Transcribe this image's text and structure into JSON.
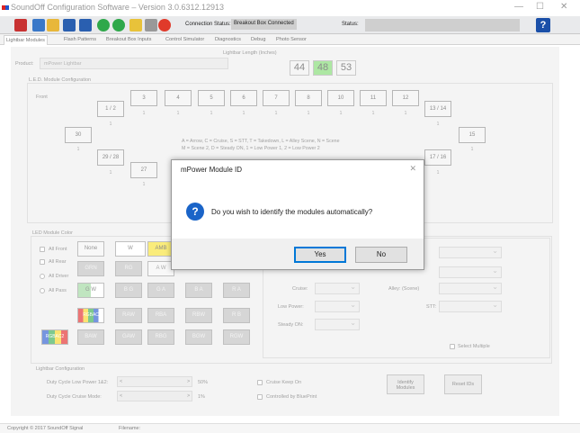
{
  "window": {
    "title": "SoundOff Configuration Software – Version 3.0.6312.12913",
    "minimize": "—",
    "maximize": "☐",
    "close": "✕"
  },
  "toolbar": {
    "connection_status_label": "Connection Status:",
    "connection_status_value": "Breakout Box Connected",
    "status_label": "Status:",
    "status_value": ""
  },
  "tabs": [
    "Lightbar Modules",
    "Flash Patterns",
    "Breakout Box Inputs",
    "Control Simulator",
    "Diagnostics",
    "Debug",
    "Photo Sensor"
  ],
  "product": {
    "label": "Product:",
    "value": "mPower Lightbar"
  },
  "lightbar_length": {
    "label": "Lightbar Length (Inches)",
    "options": [
      "44",
      "48",
      "53"
    ],
    "selected": "48",
    "selected_color": "#7bd96b"
  },
  "led_config": {
    "title": "L.E.D. Module Configuration",
    "front_label": "Front",
    "top_row": [
      "3",
      "4",
      "5",
      "6",
      "7",
      "8",
      "10",
      "11",
      "12"
    ],
    "left_box": "1 / 2",
    "right_box": "13 / 14",
    "side_left": "30",
    "side_right": "15",
    "lower_left": "29 / 28",
    "lower_right": "17 / 16",
    "mid_left": "27",
    "one_label": "1",
    "legend_line1": "A = Arrow, C = Cruise, S = STT, T = Takedown, L = Alley Scene, N = Scene",
    "legend_line2": "M = Scene 2, D = Steady ON, 1 = Low Power 1, 2 = Low Power 2"
  },
  "module_color": {
    "title": "LED Module Color",
    "options": [
      "All Front",
      "All Rear",
      "All Driver",
      "All Pass"
    ],
    "top_buttons": [
      "None",
      "W",
      "AMB"
    ],
    "row1": [
      "GRN",
      "RG"
    ],
    "row1_aw": "A W",
    "row2": [
      "G W",
      "B G",
      "G A",
      "B A",
      "R A"
    ],
    "row3": [
      "RGBAC",
      "RAW",
      "RBA",
      "RBW",
      "R B"
    ],
    "row4": [
      "RGBAC2",
      "BAW",
      "GAW",
      "RBG",
      "BGW",
      "RGW"
    ]
  },
  "functions": {
    "cruise_label": "Cruise:",
    "low_power_label": "Low Power:",
    "steady_on_label": "Steady ON:",
    "alley_label": "Alley: (Scene)",
    "stt_label": "STT:",
    "select_multiple": "Select Multiple"
  },
  "lightbar_config": {
    "title": "Lightbar Configuration",
    "duty_low_label": "Duty Cycle Low Power 1&2:",
    "duty_low_value": "50%",
    "duty_cruise_label": "Duty Cycle Cruise Mode:",
    "duty_cruise_value": "1%",
    "cruise_keep_on": "Cruise Keep On",
    "controlled_by": "Controlled by BluePrint",
    "identify_modules": "Identify Modules",
    "reset_ids": "Reset IDs"
  },
  "statusbar": {
    "copyright": "Copyright © 2017 SoundOff Signal",
    "filename_label": "Filename:"
  },
  "dialog": {
    "title": "mPower Module ID",
    "close": "✕",
    "message": "Do you wish to identify the modules automatically?",
    "icon": "?",
    "yes": "Yes",
    "no": "No"
  },
  "colors": {
    "amb": "#f7e02a",
    "selected_len": "#7bd96b",
    "dialog_accent": "#0078d7"
  }
}
